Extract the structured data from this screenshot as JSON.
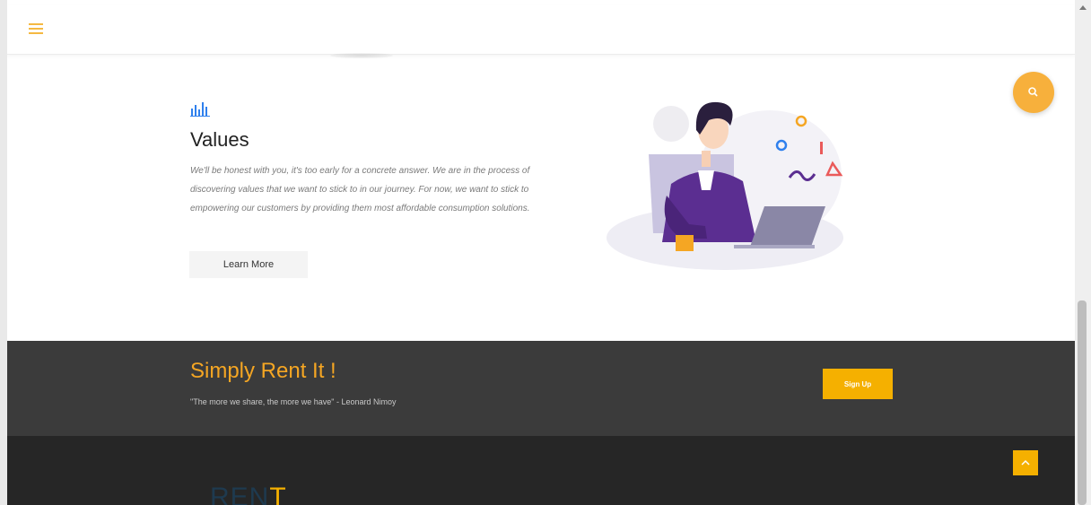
{
  "nav": {
    "menu_icon": "hamburger-menu-icon"
  },
  "values": {
    "icon": "bar-chart-icon",
    "title": "Values",
    "description": "We'll be honest with you, it's too early for a concrete answer. We are in the process of discovering values that we want to stick to in our journey. For now, we want to stick to empowering our customers by providing them most affordable consumption solutions.",
    "learn_more_label": "Learn More"
  },
  "fab": {
    "icon": "search-icon",
    "color": "#f7b03c"
  },
  "cta": {
    "title": "Simply Rent It !",
    "quote": "\"The more we share, the more we have\" - Leonard Nimoy",
    "signup_label": "Sign Up"
  },
  "footer": {
    "logo_part1": "REN",
    "logo_part2": "T",
    "back_to_top_icon": "chevron-up-icon"
  },
  "colors": {
    "accent": "#f5b000",
    "cta_title": "#f5a623",
    "cta_background": "#3b3b3b",
    "footer_background": "#262626",
    "icon_blue": "#2f80ed"
  }
}
